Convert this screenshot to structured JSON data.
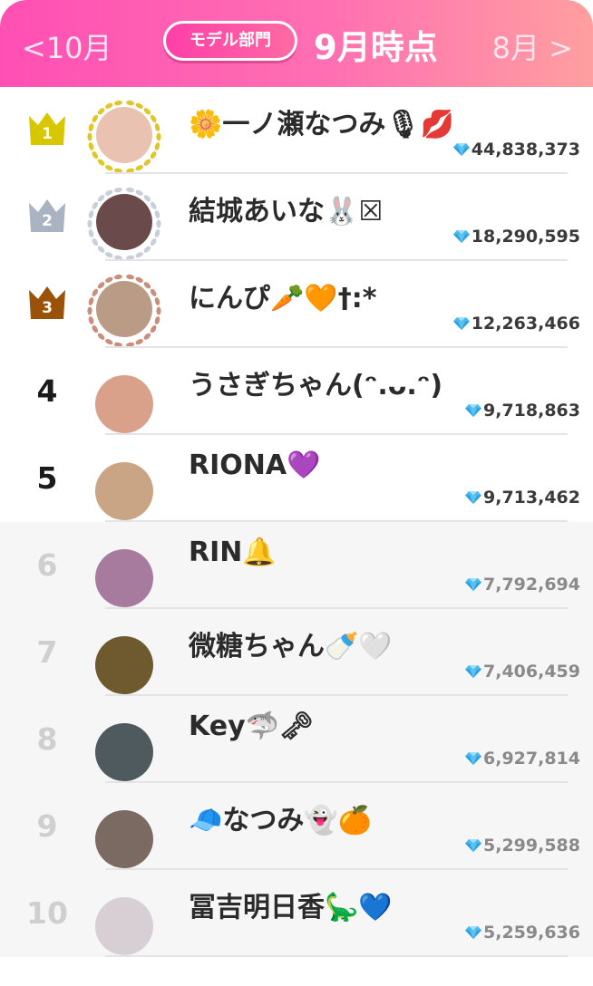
{
  "header": {
    "prev_label": "<10月",
    "section_label": "モデル部門",
    "period_title": "9月時点",
    "next_label": "8月 >"
  },
  "colors": {
    "header_gradient": [
      "#ff4fb4",
      "#ff9fa0"
    ],
    "gold": "#d8c700",
    "silver": "#aab3c2",
    "bronze": "#9b5208",
    "diamond": "#4bb8f0"
  },
  "ranking": [
    {
      "rank": "1",
      "name": "🌼一ノ瀬なつみ🎙💋",
      "score": "44,838,373",
      "crown": "gold",
      "avatar_color": "#e9c2b2"
    },
    {
      "rank": "2",
      "name": "結城あいな🐰☒",
      "score": "18,290,595",
      "crown": "silver",
      "avatar_color": "#6b4a4c"
    },
    {
      "rank": "3",
      "name": "にんぴ🥕🧡†:*",
      "score": "12,263,466",
      "crown": "bronze",
      "avatar_color": "#b99b86"
    },
    {
      "rank": "4",
      "name": "うさぎちゃん(ᵔ.ᴗ.ᵔ)",
      "score": "9,718,863",
      "crown": "",
      "avatar_color": "#d9a08a"
    },
    {
      "rank": "5",
      "name": "RIONA💜",
      "score": "9,713,462",
      "crown": "",
      "avatar_color": "#c9a585"
    },
    {
      "rank": "6",
      "name": "RIN🔔",
      "score": "7,792,694",
      "crown": "",
      "avatar_color": "#a77b9e"
    },
    {
      "rank": "7",
      "name": "微糖ちゃん🍼🤍",
      "score": "7,406,459",
      "crown": "",
      "avatar_color": "#6e5a2e"
    },
    {
      "rank": "8",
      "name": "Key🦈🗝",
      "score": "6,927,814",
      "crown": "",
      "avatar_color": "#4e5a5e"
    },
    {
      "rank": "9",
      "name": "🧢なつみ👻🍊",
      "score": "5,299,588",
      "crown": "",
      "avatar_color": "#7a6a62"
    },
    {
      "rank": "10",
      "name": "冨吉明日香🦕💙",
      "score": "5,259,636",
      "crown": "",
      "avatar_color": "#d8cfd4"
    }
  ]
}
